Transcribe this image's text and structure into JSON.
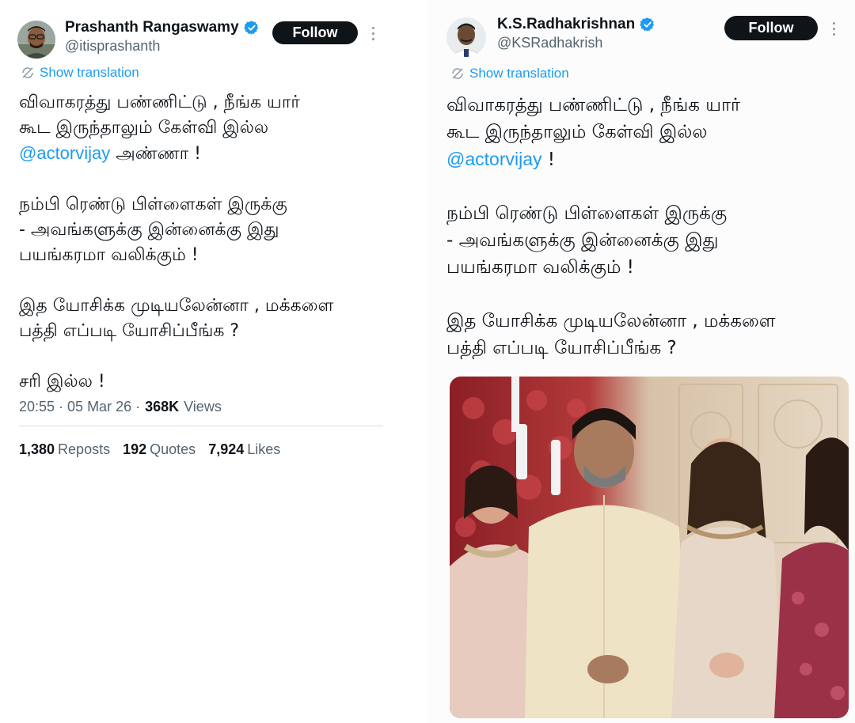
{
  "tweet_left": {
    "display_name": "Prashanth Rangaswamy",
    "handle": "@itisprashanth",
    "follow_label": "Follow",
    "show_translation": "Show translation",
    "line1": "விவாகரத்து பண்ணிட்டு , நீங்க யார்",
    "line2": "கூட இருந்தாலும் கேள்வி இல்ல",
    "mention": "@actorvijay",
    "line3_suffix": " அண்ணா !",
    "line4": "நம்பி ரெண்டு பிள்ளைகள் இருக்கு",
    "line5": "- அவங்களுக்கு இன்னைக்கு இது",
    "line6": "பயங்கரமா வலிக்கும் !",
    "line7": "இத யோசிக்க முடியலேன்னா , மக்களை",
    "line8": "பத்தி எப்படி யோசிப்பீங்க ?",
    "line9": "சரி இல்ல !",
    "time": "20:55 · 05 Mar 26 ·",
    "views_count": "368K",
    "views_label": "Views",
    "reposts_count": "1,380",
    "reposts_label": "Reposts",
    "quotes_count": "192",
    "quotes_label": "Quotes",
    "likes_count": "7,924",
    "likes_label": "Likes"
  },
  "tweet_right": {
    "display_name": "K.S.Radhakrishnan",
    "handle": "@KSRadhakrish",
    "follow_label": "Follow",
    "show_translation": "Show translation",
    "line1": "விவாகரத்து பண்ணிட்டு , நீங்க யார்",
    "line2": "கூட இருந்தாலும் கேள்வி இல்ல",
    "mention": "@actorvijay",
    "line3_suffix": "  !",
    "line4": "நம்பி ரெண்டு பிள்ளைகள் இருக்கு",
    "line5": "- அவங்களுக்கு இன்னைக்கு இது",
    "line6": "பயங்கரமா வலிக்கும் !",
    "line7": "இத யோசிக்க முடியலேன்னா , மக்களை",
    "line8": "பத்தி எப்படி யோசிப்பீங்க ?"
  },
  "colors": {
    "accent": "#1d9bf0",
    "text": "#0f1419",
    "muted": "#536471",
    "button": "#0f1419"
  },
  "icons": {
    "verified": "verified-badge-icon",
    "translate": "translate-icon",
    "more": "more-options-icon"
  }
}
